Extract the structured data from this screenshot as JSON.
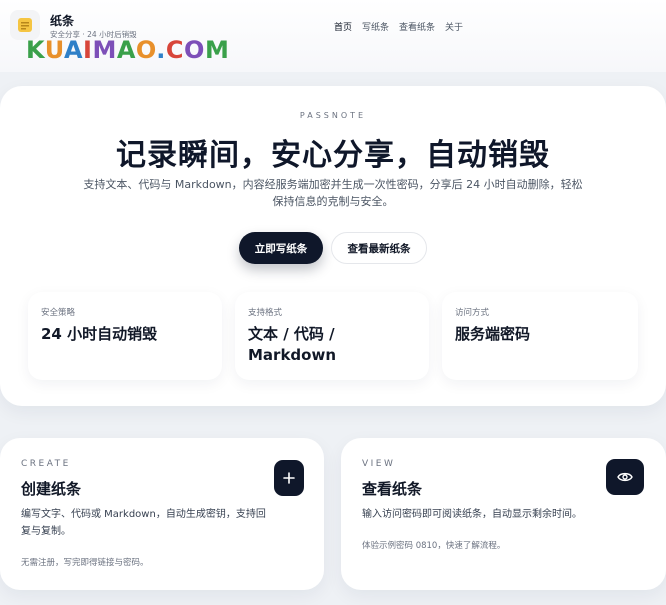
{
  "brand": {
    "title": "纸条",
    "subtitle": "安全分享 · 24 小时后销毁",
    "icon": "note-icon"
  },
  "watermark": {
    "letters": [
      "K",
      "U",
      "A",
      "I",
      "M",
      "A",
      "O",
      ".",
      "C",
      "O",
      "M"
    ],
    "colors": [
      "#3aa04a",
      "#e8902b",
      "#2f80c8",
      "#d8453a",
      "#7d4fb8",
      "#3aa04a",
      "#e8902b",
      "#2f80c8",
      "#d8453a",
      "#7d4fb8",
      "#3aa04a"
    ]
  },
  "nav": {
    "items": [
      {
        "label": "首页"
      },
      {
        "label": "写纸条"
      },
      {
        "label": "查看纸条"
      },
      {
        "label": "关于"
      }
    ]
  },
  "hero": {
    "eyebrow": "PASSNOTE",
    "title": "记录瞬间，安心分享，自动销毁",
    "description": "支持文本、代码与 Markdown，内容经服务端加密并生成一次性密码，分享后 24 小时自动删除，轻松保持信息的克制与安全。",
    "primary_button": "立即写纸条",
    "secondary_button": "查看最新纸条"
  },
  "stats": [
    {
      "label": "安全策略",
      "value": "24 小时自动销毁"
    },
    {
      "label": "支持格式",
      "value": "文本 / 代码 / Markdown"
    },
    {
      "label": "访问方式",
      "value": "服务端密码"
    }
  ],
  "cards": {
    "create": {
      "eyebrow": "CREATE",
      "title": "创建纸条",
      "description": "编写文字、代码或 Markdown，自动生成密钥，支持回复与复制。",
      "note": "无需注册，写完即得链接与密码。",
      "button_icon": "plus-icon"
    },
    "view": {
      "eyebrow": "VIEW",
      "title": "查看纸条",
      "description": "输入访问密码即可阅读纸条，自动显示剩余时间。",
      "note": "体验示例密码 0810，快速了解流程。",
      "button_icon": "eye-icon"
    }
  },
  "colors": {
    "primary": "#0f172a",
    "accent_yellow": "#f5c542",
    "background": "#eef1f5"
  }
}
